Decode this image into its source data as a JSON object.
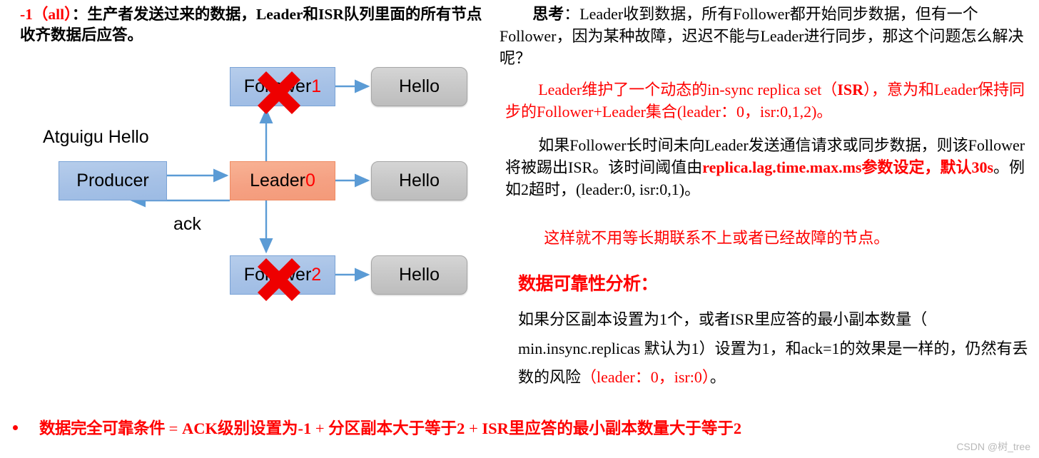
{
  "left": {
    "heading": {
      "prefix": "-1（all）",
      "body": "：生产者发送过来的数据，Leader和ISR队列里面的所有节点收齐数据后应答。"
    },
    "diagram": {
      "atguigu_label": "Atguigu Hello",
      "ack_label": "ack",
      "nodes": {
        "producer": "Producer",
        "leader_text": "Leader ",
        "leader_id": "0",
        "follower1_text": "Follower ",
        "follower1_id": "1",
        "follower2_text": "Follower ",
        "follower2_id": "2",
        "hello_top": "Hello",
        "hello_mid": "Hello",
        "hello_bot": "Hello"
      },
      "colors": {
        "blue_fill": "#a6c1e6",
        "blue_border": "#7aa3d6",
        "orange_fill": "#f5a183",
        "orange_border": "#ef8b63",
        "gray_fill": "#c9c9c9",
        "gray_border": "#a6a6a6",
        "arrow": "#5b9bd5",
        "fail_mark": "#ee0000",
        "accent_red": "#ff0000"
      },
      "fail_marks": [
        "follower1",
        "follower2"
      ]
    }
  },
  "right": {
    "think": {
      "label": "思考",
      "body": "：Leader收到数据，所有Follower都开始同步数据，但有一个Follower，因为某种故障，迟迟不能与Leader进行同步，那这个问题怎么解决呢？"
    },
    "isr_para": {
      "part1": "Leader维护了一个动态的in-sync  replica  set（",
      "bold": "ISR",
      "part2": "），意为和Leader保持同步的Follower+Leader集合(leader：0，isr:0,1,2)。"
    },
    "kick_para": {
      "part1": "如果Follower长时间未向Leader发送通信请求或同步数据，则该Follower将被踢出ISR。该时间阈值由",
      "red_bold": "replica.lag.time.max.ms参数设定，默认30s",
      "part2": "。例如2超时，(leader:0, isr:0,1)。"
    },
    "nowait_para": "这样就不用等长期联系不上或者已经故障的节点。",
    "reliability_heading": "数据可靠性分析：",
    "analysis_para": {
      "part1": "如果分区副本设置为1个，或者ISR里应答的最小副本数量（ min.insync.replicas 默认为1）设置为1，和ack=1的效果是一样的，仍然有丢数的风险",
      "red": "（leader：0，isr:0）",
      "part2": "。"
    }
  },
  "bottom": {
    "keyword": "数据完全可靠条件",
    "equals": " = ",
    "condition1": "ACK级别设置为-1",
    "plus1": " + ",
    "condition2": "分区副本大于等于2",
    "plus2": " + ",
    "condition3": "ISR里应答的最小副本数量大于等于2"
  },
  "watermark": "CSDN @树_tree"
}
